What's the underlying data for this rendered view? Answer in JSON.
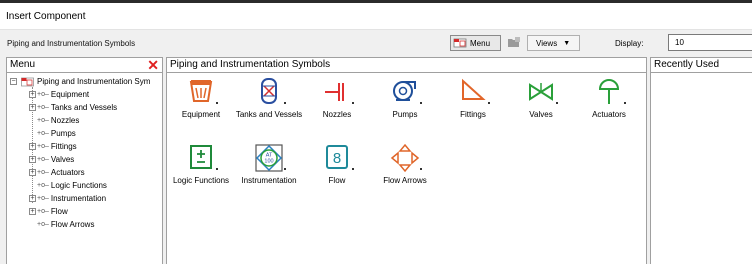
{
  "window": {
    "title": "Insert Component"
  },
  "toolbar": {
    "path_label": "Piping and Instrumentation Symbols",
    "menu_button": "Menu",
    "views_button": "Views",
    "display_label": "Display:",
    "display_value": "10"
  },
  "menu_panel": {
    "header": "Menu",
    "root": "Piping and Instrumentation Sym",
    "items": [
      {
        "label": "Equipment",
        "expandable": true
      },
      {
        "label": "Tanks and Vessels",
        "expandable": true
      },
      {
        "label": "Nozzles",
        "expandable": false
      },
      {
        "label": "Pumps",
        "expandable": false
      },
      {
        "label": "Fittings",
        "expandable": true
      },
      {
        "label": "Valves",
        "expandable": true
      },
      {
        "label": "Actuators",
        "expandable": true
      },
      {
        "label": "Logic Functions",
        "expandable": false
      },
      {
        "label": "Instrumentation",
        "expandable": true
      },
      {
        "label": "Flow",
        "expandable": true
      },
      {
        "label": "Flow Arrows",
        "expandable": false
      }
    ]
  },
  "main_panel": {
    "header": "Piping and Instrumentation Symbols",
    "symbols": [
      {
        "label": "Equipment",
        "icon": "equipment-icon",
        "color": "#e0662a"
      },
      {
        "label": "Tanks and Vessels",
        "icon": "tank-icon",
        "color": "#2a4fa0"
      },
      {
        "label": "Nozzles",
        "icon": "nozzle-icon",
        "color": "#e03030"
      },
      {
        "label": "Pumps",
        "icon": "pump-icon",
        "color": "#1f4f9a"
      },
      {
        "label": "Fittings",
        "icon": "fitting-icon",
        "color": "#e2662a"
      },
      {
        "label": "Valves",
        "icon": "valve-icon",
        "color": "#2aa03a"
      },
      {
        "label": "Actuators",
        "icon": "actuator-icon",
        "color": "#2aa03a"
      },
      {
        "label": "Logic Functions",
        "icon": "logic-icon",
        "color": "#1f8a3a"
      },
      {
        "label": "Instrumentation",
        "icon": "instrumentation-icon",
        "color": "#2aa03a",
        "badge_top": "AT",
        "badge_bottom": "100"
      },
      {
        "label": "Flow",
        "icon": "flow-icon",
        "color": "#1f8a9a"
      },
      {
        "label": "Flow Arrows",
        "icon": "flow-arrows-icon",
        "color": "#e0662a"
      }
    ]
  },
  "recent_panel": {
    "header": "Recently Used"
  }
}
